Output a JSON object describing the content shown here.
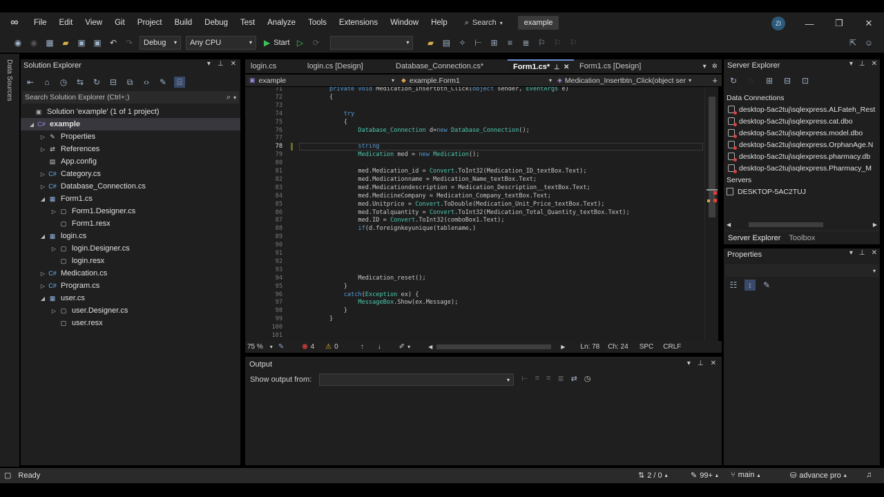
{
  "menu": [
    "File",
    "Edit",
    "View",
    "Git",
    "Project",
    "Build",
    "Debug",
    "Test",
    "Analyze",
    "Tools",
    "Extensions",
    "Window",
    "Help"
  ],
  "search_label": "Search",
  "solution_name": "example",
  "avatar_initials": "ZI",
  "toolbar": {
    "config": "Debug",
    "platform": "Any CPU",
    "start_label": "Start"
  },
  "left_strip_label": "Data Sources",
  "solution_explorer": {
    "title": "Solution Explorer",
    "search_placeholder": "Search Solution Explorer (Ctrl+;)",
    "rows": [
      {
        "label": "Solution 'example' (1 of 1 project)",
        "icon": "solution-icon",
        "arrow": "",
        "bold": false
      },
      {
        "label": "example",
        "icon": "csharp-project-icon",
        "arrow": "◢",
        "bold": true
      },
      {
        "label": "Properties",
        "icon": "wrench-icon",
        "arrow": "▷",
        "bold": false
      },
      {
        "label": "References",
        "icon": "references-icon",
        "arrow": "▷",
        "bold": false
      },
      {
        "label": "App.config",
        "icon": "config-file-icon",
        "arrow": "",
        "bold": false
      },
      {
        "label": "Category.cs",
        "icon": "csharp-file-icon",
        "arrow": "▷",
        "bold": false
      },
      {
        "label": "Database_Connection.cs",
        "icon": "csharp-file-icon",
        "arrow": "▷",
        "bold": false
      },
      {
        "label": "Form1.cs",
        "icon": "form-icon",
        "arrow": "◢",
        "bold": false
      },
      {
        "label": "Form1.Designer.cs",
        "icon": "designer-file-icon",
        "arrow": "▷",
        "bold": false
      },
      {
        "label": "Form1.resx",
        "icon": "resx-file-icon",
        "arrow": "",
        "bold": false
      },
      {
        "label": "login.cs",
        "icon": "form-icon",
        "arrow": "◢",
        "bold": false
      },
      {
        "label": "login.Designer.cs",
        "icon": "designer-file-icon",
        "arrow": "▷",
        "bold": false
      },
      {
        "label": "login.resx",
        "icon": "resx-file-icon",
        "arrow": "",
        "bold": false
      },
      {
        "label": "Medication.cs",
        "icon": "csharp-file-icon",
        "arrow": "▷",
        "bold": false
      },
      {
        "label": "Program.cs",
        "icon": "csharp-file-icon",
        "arrow": "▷",
        "bold": false
      },
      {
        "label": "user.cs",
        "icon": "form-icon",
        "arrow": "◢",
        "bold": false
      },
      {
        "label": "user.Designer.cs",
        "icon": "designer-file-icon",
        "arrow": "▷",
        "bold": false
      },
      {
        "label": "user.resx",
        "icon": "resx-file-icon",
        "arrow": "",
        "bold": false
      }
    ]
  },
  "editor": {
    "tabs": [
      "login.cs",
      "login.cs [Design]",
      "Database_Connection.cs*",
      "Form1.cs*",
      "Form1.cs [Design]"
    ],
    "active_tab": "Form1.cs*",
    "nav_project": "example",
    "nav_class": "example.Form1",
    "nav_member": "Medication_Insertbtn_Click(object ser",
    "lines": [
      {
        "n": "71",
        "text": "private void Medication_Insertbtn_Click(object sender, EventArgs e)"
      },
      {
        "n": "72",
        "text": "{"
      },
      {
        "n": "73",
        "text": ""
      },
      {
        "n": "74",
        "text": "    try"
      },
      {
        "n": "75",
        "text": "    {"
      },
      {
        "n": "76",
        "text": "        Database_Connection d=new Database_Connection();"
      },
      {
        "n": "77",
        "text": ""
      },
      {
        "n": "78",
        "text": "        string"
      },
      {
        "n": "79",
        "text": "        Medication med = new Medication();"
      },
      {
        "n": "80",
        "text": ""
      },
      {
        "n": "81",
        "text": "        med.Medication_id = Convert.ToInt32(Medication_ID_textBox.Text);"
      },
      {
        "n": "82",
        "text": "        med.Medicationname = Medication_Name_textBox.Text;"
      },
      {
        "n": "83",
        "text": "        med.Medicationdescription = Medication_Description__textBox.Text;"
      },
      {
        "n": "84",
        "text": "        med.MedicineCompany = Medication_Company_textBox.Text;"
      },
      {
        "n": "85",
        "text": "        med.Unitprice = Convert.ToDouble(Medication_Unit_Price_textBox.Text);"
      },
      {
        "n": "86",
        "text": "        med.Totalquantity = Convert.ToInt32(Medication_Total_Quantity_textBox.Text);"
      },
      {
        "n": "87",
        "text": "        med.ID = Convert.ToInt32(comboBox1.Text);"
      },
      {
        "n": "88",
        "text": "        if(d.foreignkeyunique(tablename,)"
      },
      {
        "n": "89",
        "text": ""
      },
      {
        "n": "90",
        "text": ""
      },
      {
        "n": "91",
        "text": ""
      },
      {
        "n": "92",
        "text": ""
      },
      {
        "n": "93",
        "text": ""
      },
      {
        "n": "94",
        "text": "        Medication_reset();"
      },
      {
        "n": "95",
        "text": "    }"
      },
      {
        "n": "96",
        "text": "    catch(Exception ex) {"
      },
      {
        "n": "97",
        "text": "        MessageBox.Show(ex.Message);"
      },
      {
        "n": "98",
        "text": "    }"
      },
      {
        "n": "99",
        "text": "}"
      },
      {
        "n": "100",
        "text": ""
      },
      {
        "n": "101",
        "text": ""
      }
    ],
    "current_line": "78",
    "zoom": "75 %",
    "errors": "4",
    "warnings": "0",
    "ln": "Ln: 78",
    "ch": "Ch: 24",
    "spc": "SPC",
    "crlf": "CRLF"
  },
  "output": {
    "title": "Output",
    "show_from_label": "Show output from:"
  },
  "server_explorer": {
    "title": "Server Explorer",
    "data_connections_label": "Data Connections",
    "connections": [
      "desktop-5ac2tuj\\sqlexpress.ALFateh_Rest",
      "desktop-5ac2tuj\\sqlexpress.cat.dbo",
      "desktop-5ac2tuj\\sqlexpress.model.dbo",
      "desktop-5ac2tuj\\sqlexpress.OrphanAge.N",
      "desktop-5ac2tuj\\sqlexpress.pharmacy.db",
      "desktop-5ac2tuj\\sqlexpress.Pharmacy_M"
    ],
    "servers_label": "Servers",
    "server_name": "DESKTOP-5AC2TUJ",
    "bottom_tabs": [
      "Server Explorer",
      "Toolbox"
    ]
  },
  "properties": {
    "title": "Properties"
  },
  "statusbar": {
    "ready": "Ready",
    "git_changes": "2 / 0",
    "edits": "99+",
    "branch": "main",
    "repo": "advance pro"
  },
  "colors": {
    "accent": "#6b8fd6",
    "error": "#e04040",
    "warning": "#e8c03c",
    "start": "#3fbf5a"
  }
}
